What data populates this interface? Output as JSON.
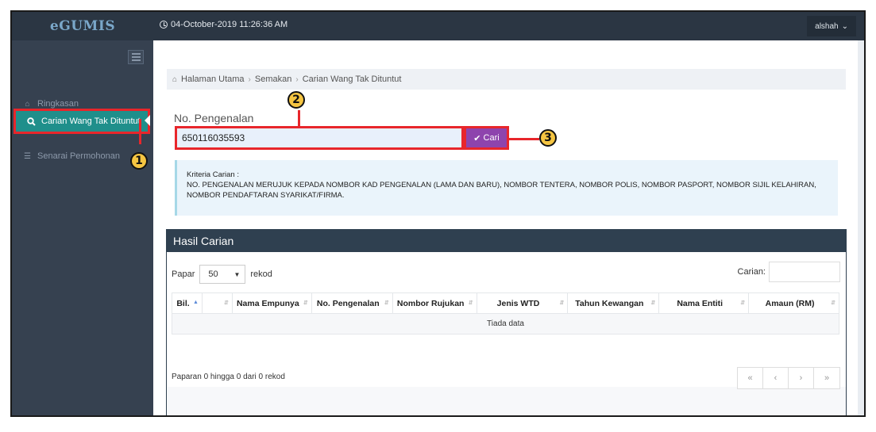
{
  "app": {
    "logo": "eGUMIS",
    "datetime": "04-October-2019 11:26:36 AM",
    "user": "alshah"
  },
  "sidebar": {
    "items": [
      {
        "label": "Ringkasan",
        "icon": "home-icon"
      },
      {
        "label": "Carian Wang Tak Dituntut",
        "icon": "search-icon"
      },
      {
        "label": "Senarai Permohonan",
        "icon": "list-icon"
      }
    ]
  },
  "breadcrumb": [
    "Halaman Utama",
    "Semakan",
    "Carian Wang Tak Dituntut"
  ],
  "form": {
    "label": "No. Pengenalan",
    "value": "650116035593",
    "button": "Cari"
  },
  "note": {
    "title": "Kriteria Carian :",
    "text": "NO. PENGENALAN MERUJUK KEPADA NOMBOR KAD PENGENALAN (LAMA DAN BARU), NOMBOR TENTERA, NOMBOR POLIS, NOMBOR PASPORT, NOMBOR SIJIL KELAHIRAN, NOMBOR PENDAFTARAN SYARIKAT/FIRMA."
  },
  "results": {
    "title": "Hasil Carian",
    "length_prefix": "Papar",
    "length_value": "50",
    "length_suffix": "rekod",
    "search_label": "Carian:",
    "columns": [
      "Bil.",
      "",
      "Nama Empunya",
      "No. Pengenalan",
      "Nombor Rujukan",
      "Jenis WTD",
      "Tahun Kewangan",
      "Nama Entiti",
      "Amaun (RM)"
    ],
    "empty": "Tiada data",
    "info": "Paparan 0 hingga 0 dari 0 rekod",
    "pager": [
      "«",
      "‹",
      "›",
      "»"
    ]
  },
  "callouts": [
    "1",
    "2",
    "3"
  ],
  "colors": {
    "accent": "#8e44ad",
    "active": "#1f8f8b",
    "highlight": "#e8262b",
    "callout": "#f5c542"
  }
}
